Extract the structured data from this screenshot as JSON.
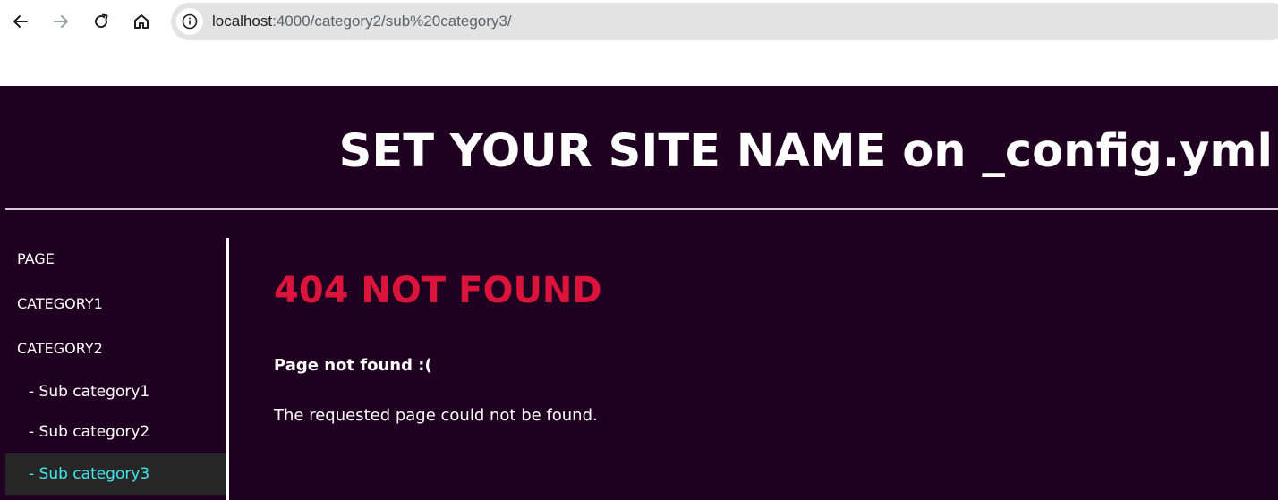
{
  "browser": {
    "url_host": "localhost",
    "url_path": ":4000/category2/sub%20category3/",
    "icons": [
      "back-arrow-icon",
      "forward-arrow-icon",
      "reload-icon",
      "home-icon",
      "info-icon"
    ]
  },
  "site": {
    "title": "SET YOUR SITE NAME on _config.yml",
    "colors": {
      "background": "#200020",
      "error_title": "#dc143c",
      "active_link": "#3fe8f0",
      "active_bg": "#262626"
    }
  },
  "sidebar": {
    "items": [
      {
        "label": "PAGE"
      },
      {
        "label": "CATEGORY1"
      },
      {
        "label": "CATEGORY2"
      },
      {
        "label": "- Sub category1"
      },
      {
        "label": "- Sub category2"
      },
      {
        "label": "- Sub category3"
      }
    ]
  },
  "content": {
    "title": "404 NOT FOUND",
    "subtitle": "Page not found :(",
    "description": "The requested page could not be found."
  }
}
